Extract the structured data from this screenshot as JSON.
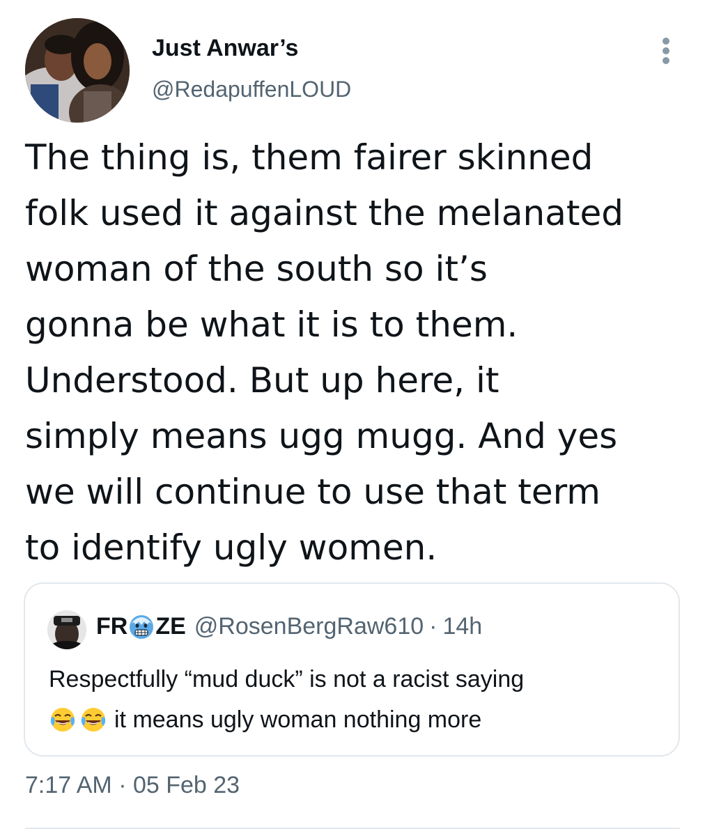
{
  "author": {
    "display_name": "Just Anwar’s",
    "handle": "@RedapuffenLOUD",
    "avatar_icon": "profile-photo-couple"
  },
  "tweet": {
    "text": "The thing is, them fairer skinned\nfolk used it against the melanated\nwoman of the south so it’s\ngonna be what it is to them.\nUnderstood. But up here, it\nsimply means ugg mugg. And yes\nwe will continue to use that term\nto identify ugly women.",
    "timestamp": "7:17 AM · 05 Feb 23"
  },
  "quoted": {
    "name_part1": "FR",
    "name_emoji": "cold-face-icon",
    "name_part2": "ZE",
    "handle": "@RosenBergRaw610",
    "dot": "·",
    "time": "14h",
    "line1": "Respectfully “mud duck” is not a racist saying",
    "line2": "it means ugly woman nothing more",
    "emojis": [
      "face-with-tears-of-joy-icon",
      "face-with-tears-of-joy-icon"
    ]
  },
  "colors": {
    "text_primary": "#0f1419",
    "text_secondary": "#536471",
    "border": "#e1e8ed"
  }
}
